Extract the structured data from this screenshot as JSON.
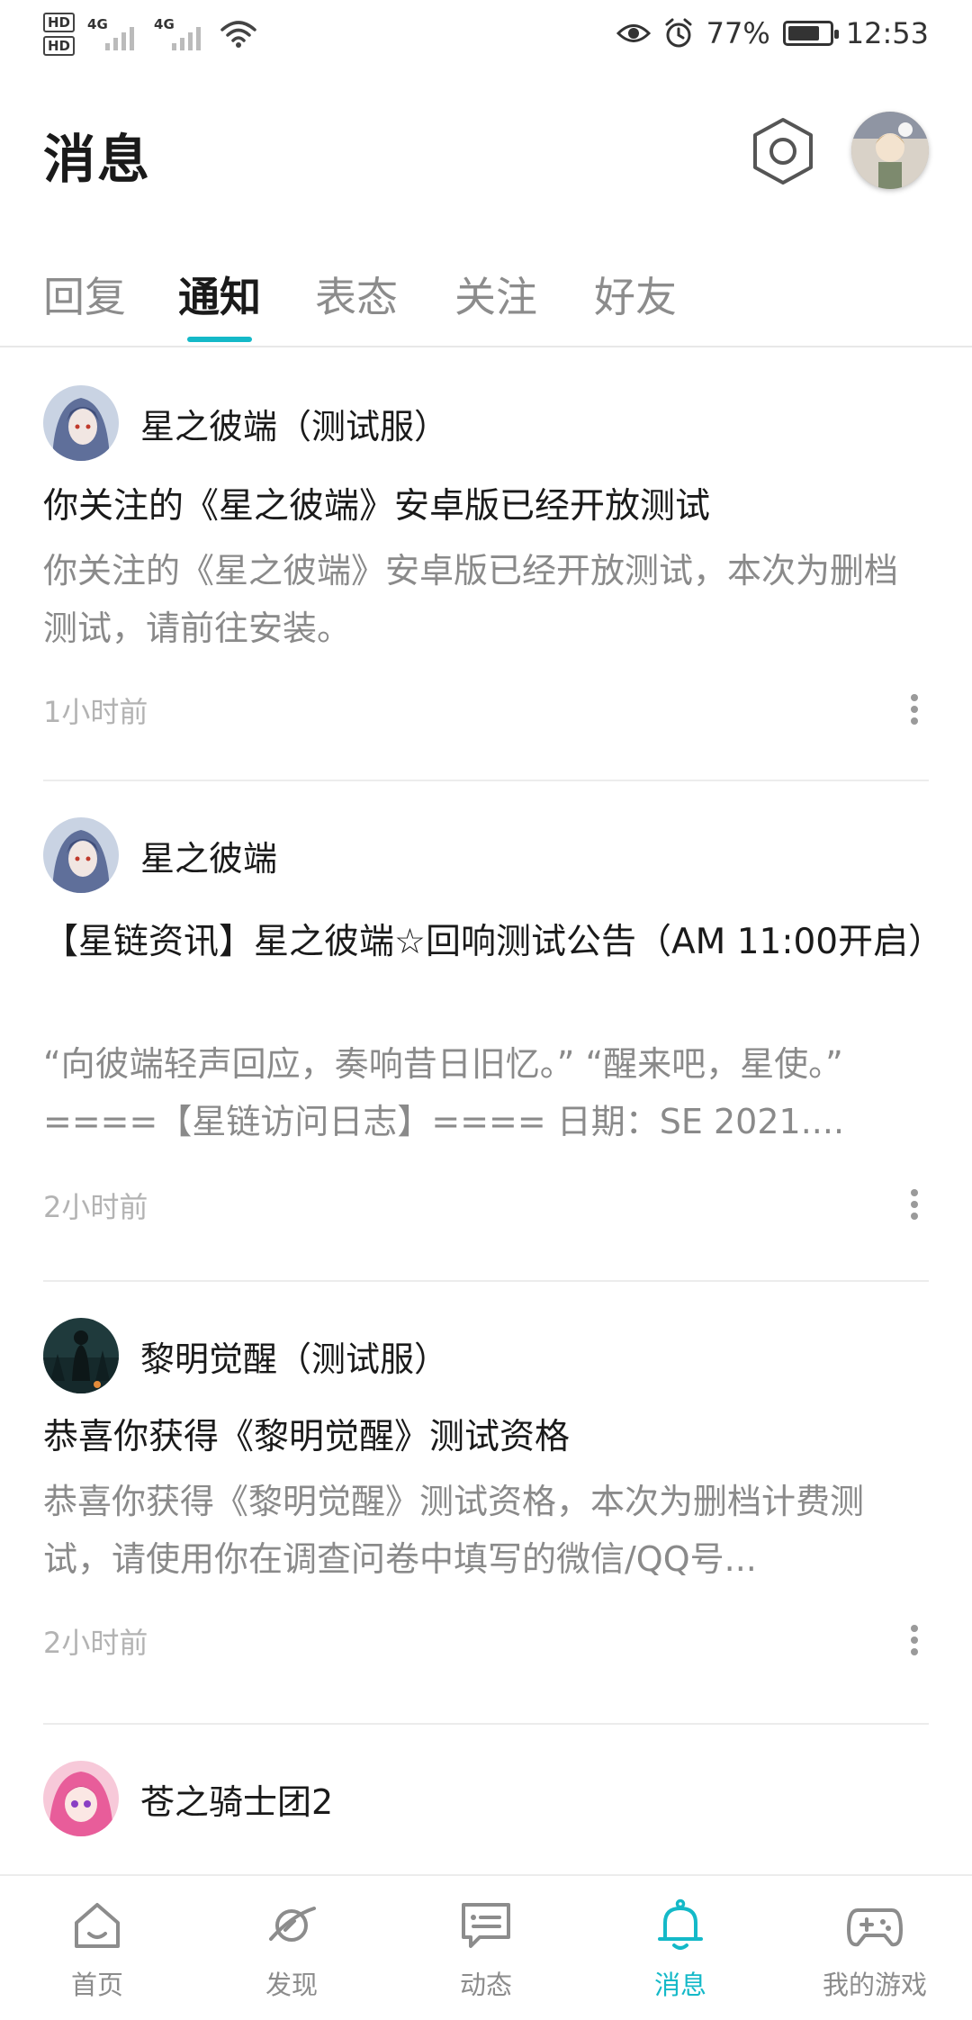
{
  "status_bar": {
    "hd1": "HD",
    "hd2": "HD",
    "net1": "4G",
    "net2": "4G",
    "battery_percent": "77%",
    "battery_level": 0.77,
    "time": "12:53"
  },
  "header": {
    "title": "消息"
  },
  "tabs": [
    {
      "label": "回复"
    },
    {
      "label": "通知"
    },
    {
      "label": "表态"
    },
    {
      "label": "关注"
    },
    {
      "label": "好友"
    }
  ],
  "active_tab": "通知",
  "notifications": [
    {
      "game": "星之彼端（测试服）",
      "title": "你关注的《星之彼端》安卓版已经开放测试",
      "body": "你关注的《星之彼端》安卓版已经开放测试，本次为删档测试，请前往安装。",
      "time": "1小时前"
    },
    {
      "game": "星之彼端",
      "title": "【星链资讯】星之彼端☆回响测试公告（AM 11:00开启）",
      "body": "“向彼端轻声回应，奏响昔日旧忆。” “醒来吧，星使。” ====【星链访问日志】==== 日期：SE 2021....",
      "time": "2小时前"
    },
    {
      "game": "黎明觉醒（测试服）",
      "title": "恭喜你获得《黎明觉醒》测试资格",
      "body": "恭喜你获得《黎明觉醒》测试资格，本次为删档计费测试，请使用你在调查问卷中填写的微信/QQ号...",
      "time": "2小时前"
    },
    {
      "game": "苍之骑士团2"
    }
  ],
  "bottom_nav": [
    {
      "label": "首页",
      "icon": "home-icon"
    },
    {
      "label": "发现",
      "icon": "planet-icon"
    },
    {
      "label": "动态",
      "icon": "chat-bubble-icon"
    },
    {
      "label": "消息",
      "icon": "bell-icon"
    },
    {
      "label": "我的游戏",
      "icon": "gamepad-icon"
    }
  ],
  "colors": {
    "accent": "#14b9c8",
    "text_primary": "#1a1a1a",
    "text_secondary": "#8a8a8a",
    "text_muted": "#b3b3b3"
  }
}
